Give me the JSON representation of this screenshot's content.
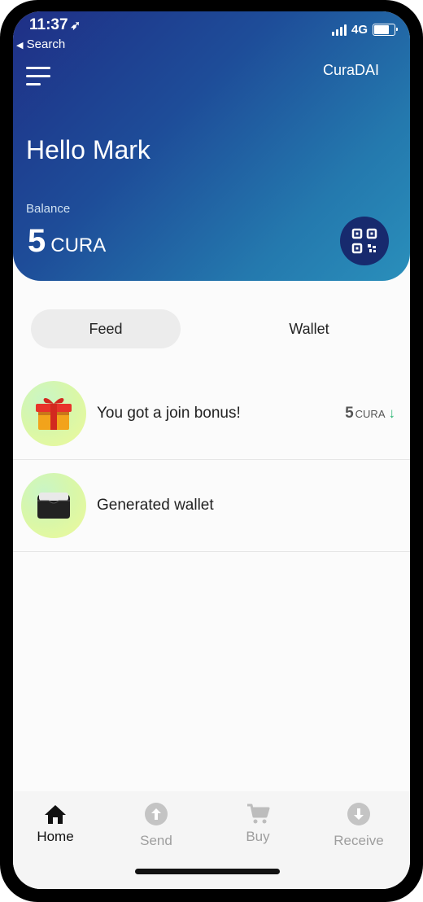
{
  "status_bar": {
    "time": "11:37",
    "back_label": "Search",
    "network": "4G"
  },
  "header": {
    "brand": "CuraDAI",
    "greeting": "Hello Mark",
    "balance_label": "Balance",
    "balance_value": "5",
    "balance_unit": "CURA"
  },
  "tabs": [
    {
      "label": "Feed",
      "active": true
    },
    {
      "label": "Wallet",
      "active": false
    }
  ],
  "feed": [
    {
      "text": "You got a join bonus!",
      "amount": "5",
      "unit": "CURA",
      "icon": "gift-icon",
      "direction": "incoming"
    },
    {
      "text": "Generated wallet",
      "icon": "wallet-icon"
    }
  ],
  "nav": [
    {
      "label": "Home",
      "icon": "home-icon",
      "active": true
    },
    {
      "label": "Send",
      "icon": "arrow-up-icon",
      "active": false
    },
    {
      "label": "Buy",
      "icon": "cart-icon",
      "active": false
    },
    {
      "label": "Receive",
      "icon": "arrow-down-icon",
      "active": false
    }
  ],
  "colors": {
    "header_gradient_start": "#1f2f86",
    "header_gradient_end": "#2a8fbb",
    "qr_button": "#172a6e",
    "incoming_arrow": "#2bb673",
    "nav_inactive": "#9e9e9e",
    "nav_active": "#111111"
  }
}
